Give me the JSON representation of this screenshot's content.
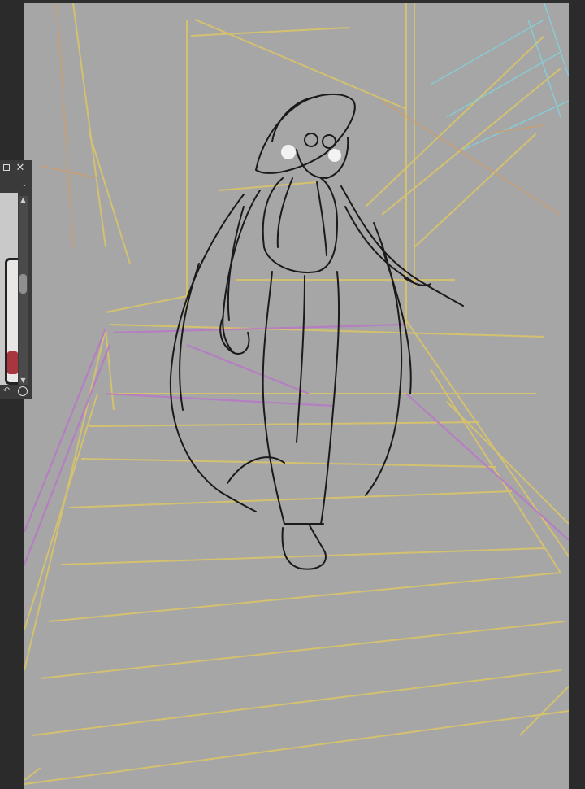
{
  "app": {
    "canvas_background": "#a6a6a6",
    "frame_background": "#2b2b2b"
  },
  "navigator_panel": {
    "maximize_icon": "maximize-icon",
    "close_icon": "close-icon",
    "close_glyph": "✕",
    "dropdown_glyph": "⌄",
    "scroll_up_glyph": "▲",
    "scroll_down_glyph": "▼",
    "rotate_glyph": "↶",
    "reset_glyph": "⏻"
  },
  "sketch": {
    "layer_colors": {
      "line_art": "#1a1a1a",
      "perspective_yellow": "#d9c46a",
      "railing_purple": "#b878c8",
      "highlight_cyan": "#7fd6e0",
      "accent_orange": "#d69a5e",
      "accent_green": "#8fc48a"
    }
  }
}
